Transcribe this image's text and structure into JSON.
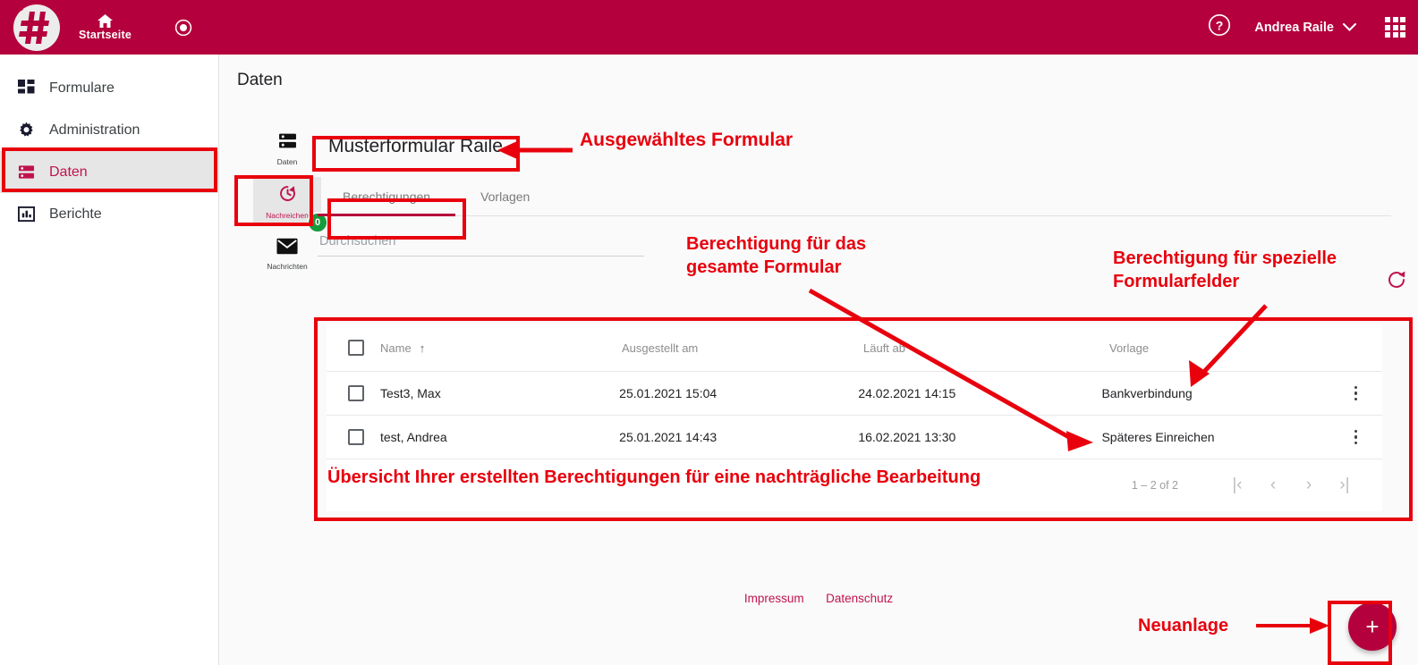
{
  "topbar": {
    "logo_icon": "hash-circle-logo",
    "home": {
      "icon": "home-icon",
      "label": "Startseite"
    },
    "record_icon": "record-circle-icon",
    "help_icon": "help-circle-icon",
    "user": {
      "name": "Andrea Raile",
      "chevron_icon": "chevron-down-icon"
    },
    "apps_icon": "apps-grid-icon",
    "background_color": "#b4003c"
  },
  "sidebar": {
    "items": [
      {
        "label": "Formulare",
        "icon": "dashboard-icon",
        "active": false
      },
      {
        "label": "Administration",
        "icon": "gear-icon",
        "active": false
      },
      {
        "label": "Daten",
        "icon": "database-icon",
        "active": true
      },
      {
        "label": "Berichte",
        "icon": "bar-chart-icon",
        "active": false
      }
    ]
  },
  "main": {
    "page_title": "Daten",
    "rail": [
      {
        "label": "Daten",
        "icon": "database-icon",
        "active": false,
        "badge": null
      },
      {
        "label": "Nachreichen",
        "icon": "history-restore-icon",
        "active": true,
        "badge": "0"
      },
      {
        "label": "Nachrichten",
        "icon": "envelope-icon",
        "active": false,
        "badge": null
      }
    ],
    "form_title": "Musterformular Raile",
    "tabs": [
      {
        "label": "Berechtigungen",
        "active": true
      },
      {
        "label": "Vorlagen",
        "active": false
      }
    ],
    "search": {
      "value": "",
      "placeholder": "Durchsuchen"
    },
    "refresh_icon": "refresh-icon",
    "table": {
      "columns": [
        "Name",
        "Ausgestellt am",
        "Läuft ab",
        "Vorlage"
      ],
      "sort_column": "Name",
      "sort_direction": "ascending",
      "sort_icon": "arrow-up-icon",
      "rows": [
        {
          "checked": false,
          "name": "Test3, Max",
          "issued": "25.01.2021 15:04",
          "expires": "24.02.2021 14:15",
          "template": "Bankverbindung",
          "menu_icon": "kebab-menu-icon"
        },
        {
          "checked": false,
          "name": "test, Andrea",
          "issued": "25.01.2021 14:43",
          "expires": "16.02.2021 13:30",
          "template": "Späteres Einreichen",
          "menu_icon": "kebab-menu-icon"
        }
      ]
    },
    "paginator": {
      "range": "1 – 2 of 2",
      "first_icon": "first-page-icon",
      "prev_icon": "previous-page-icon",
      "next_icon": "next-page-icon",
      "last_icon": "last-page-icon"
    },
    "footer_links": [
      "Impressum",
      "Datenschutz"
    ],
    "fab": {
      "label": "+",
      "icon": "plus-icon"
    }
  },
  "annotations": {
    "color": "#e8000d",
    "selected_form": "Ausgewähltes Formular",
    "whole_form_permission": "Berechtigung für das\ngesamte Formular",
    "special_fields_permission": "Berechtigung für spezielle\nFormularfelder",
    "overview": "Übersicht Ihrer erstellten Berechtigungen für eine nachträgliche Bearbeitung",
    "new_entry": "Neuanlage"
  }
}
